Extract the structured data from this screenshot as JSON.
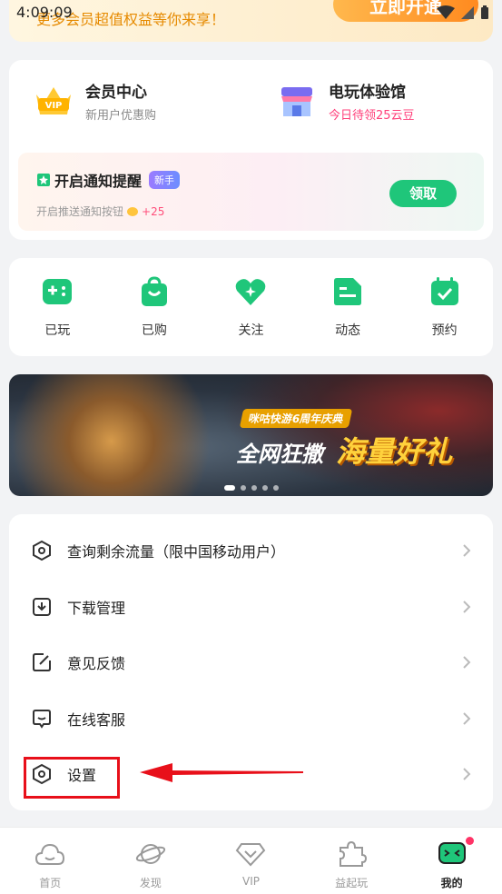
{
  "status": {
    "time": "4:09:09"
  },
  "promo": {
    "text": "更多会员超值权益等你来享！",
    "button": "立即开通"
  },
  "member": {
    "vip": {
      "title": "会员中心",
      "sub": "新用户优惠购"
    },
    "arcade": {
      "title": "电玩体验馆",
      "sub": "今日待领25云豆"
    },
    "notify": {
      "title": "开启通知提醒",
      "tag": "新手",
      "sub": "开启推送通知按钮",
      "points": "+25",
      "button": "领取"
    }
  },
  "shortcuts": [
    {
      "label": "已玩",
      "icon": "gamepad-icon"
    },
    {
      "label": "已购",
      "icon": "shopping-bag-icon"
    },
    {
      "label": "关注",
      "icon": "heart-icon"
    },
    {
      "label": "动态",
      "icon": "feed-icon"
    },
    {
      "label": "预约",
      "icon": "calendar-icon"
    }
  ],
  "banner": {
    "subtitle": "咪咕快游6周年庆典",
    "title1": "全网狂撒",
    "title2": "海量好礼",
    "slides": 5,
    "active_slide": 1
  },
  "menu": [
    {
      "label": "查询剩余流量（限中国移动用户）",
      "icon": "data-traffic-icon"
    },
    {
      "label": "下载管理",
      "icon": "download-icon"
    },
    {
      "label": "意见反馈",
      "icon": "feedback-icon"
    },
    {
      "label": "在线客服",
      "icon": "customer-service-icon"
    },
    {
      "label": "设置",
      "icon": "settings-icon"
    }
  ],
  "tabs": [
    {
      "label": "首页",
      "icon": "home-cloud-icon"
    },
    {
      "label": "发现",
      "icon": "planet-icon"
    },
    {
      "label": "VIP",
      "icon": "diamond-icon"
    },
    {
      "label": "益起玩",
      "icon": "puzzle-icon"
    },
    {
      "label": "我的",
      "icon": "profile-face-icon",
      "active": true
    }
  ],
  "colors": {
    "accent_green": "#1fc67a",
    "highlight_red": "#e8101a",
    "promo_orange": "#ff8a1f"
  }
}
